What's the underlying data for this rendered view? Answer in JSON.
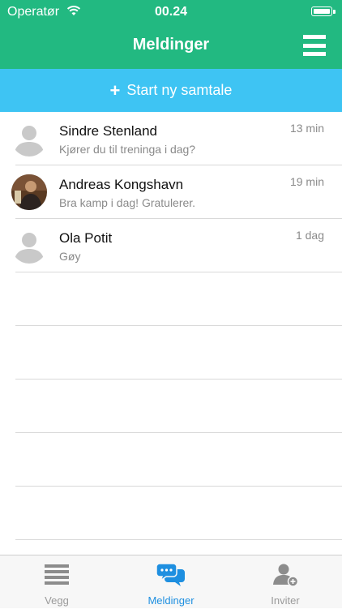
{
  "status_bar": {
    "carrier": "Operatør",
    "time": "00.24"
  },
  "header": {
    "title": "Meldinger"
  },
  "new_conversation": {
    "label": "Start ny samtale"
  },
  "conversations": [
    {
      "name": "Sindre Stenland",
      "preview": "Kjører du til treninga i dag?",
      "time": "13 min",
      "avatar": "default-avatar"
    },
    {
      "name": "Andreas Kongshavn",
      "preview": "Bra kamp i dag! Gratulerer.",
      "time": "19 min",
      "avatar": "photo-avatar"
    },
    {
      "name": "Ola Potit",
      "preview": "Gøy",
      "time": "1 dag",
      "avatar": "default-avatar"
    }
  ],
  "tabs": [
    {
      "label": "Vegg",
      "icon": "list-icon",
      "active": false
    },
    {
      "label": "Meldinger",
      "icon": "chat-bubbles-icon",
      "active": true
    },
    {
      "label": "Inviter",
      "icon": "add-user-icon",
      "active": false
    }
  ],
  "colors": {
    "header": "#22b981",
    "action_bar": "#3ec4f3",
    "active_tab": "#1e8fe0",
    "inactive_tab": "#9a9a9a"
  }
}
